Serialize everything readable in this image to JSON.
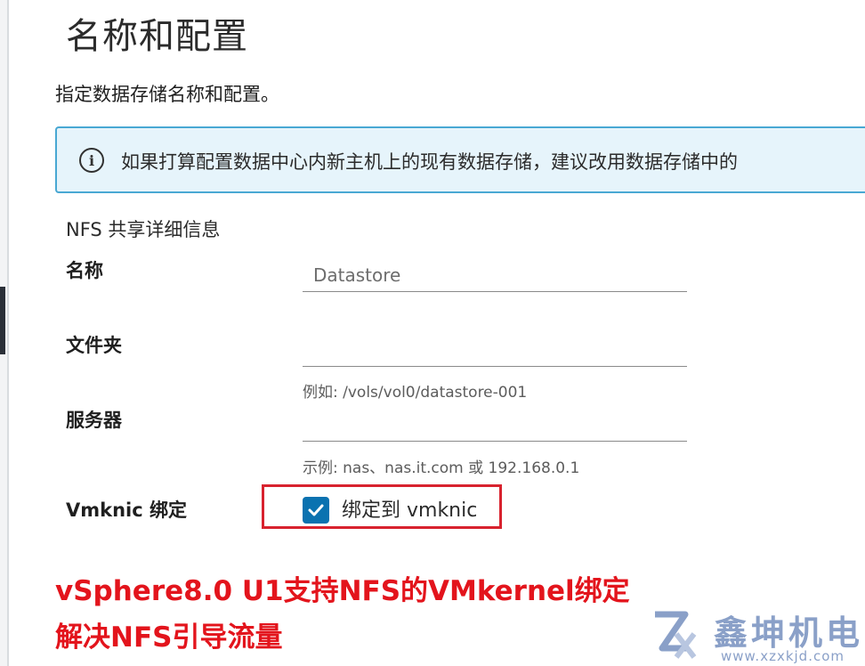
{
  "page_title": "名称和配置",
  "subtitle": "指定数据存储名称和配置。",
  "info_banner": {
    "icon": "info-icon",
    "text": "如果打算配置数据中心内新主机上的现有数据存储，建议改用数据存储中的"
  },
  "section_title": "NFS 共享详细信息",
  "fields": {
    "name": {
      "label": "名称",
      "value": "",
      "placeholder": "Datastore"
    },
    "folder": {
      "label": "文件夹",
      "value": "",
      "placeholder": "",
      "helper": "例如: /vols/vol0/datastore-001"
    },
    "server": {
      "label": "服务器",
      "value": "",
      "placeholder": "",
      "helper": "示例: nas、nas.it.com 或 192.168.0.1"
    }
  },
  "vmknic": {
    "label": "Vmknic 绑定",
    "checkbox_label": "绑定到 vmknic",
    "checked": true
  },
  "annotation": {
    "line1": "vSphere8.0 U1支持NFS的VMkernel绑定",
    "line2": "解决NFS引导流量",
    "color": "#e3141c"
  },
  "watermark": {
    "text": "鑫坤机电",
    "url": "www.xzxkjd.com"
  },
  "colors": {
    "accent": "#0a72b0",
    "banner_bg": "#e6f4fb",
    "banner_border": "#49a8d3",
    "highlight": "#d8222e"
  }
}
